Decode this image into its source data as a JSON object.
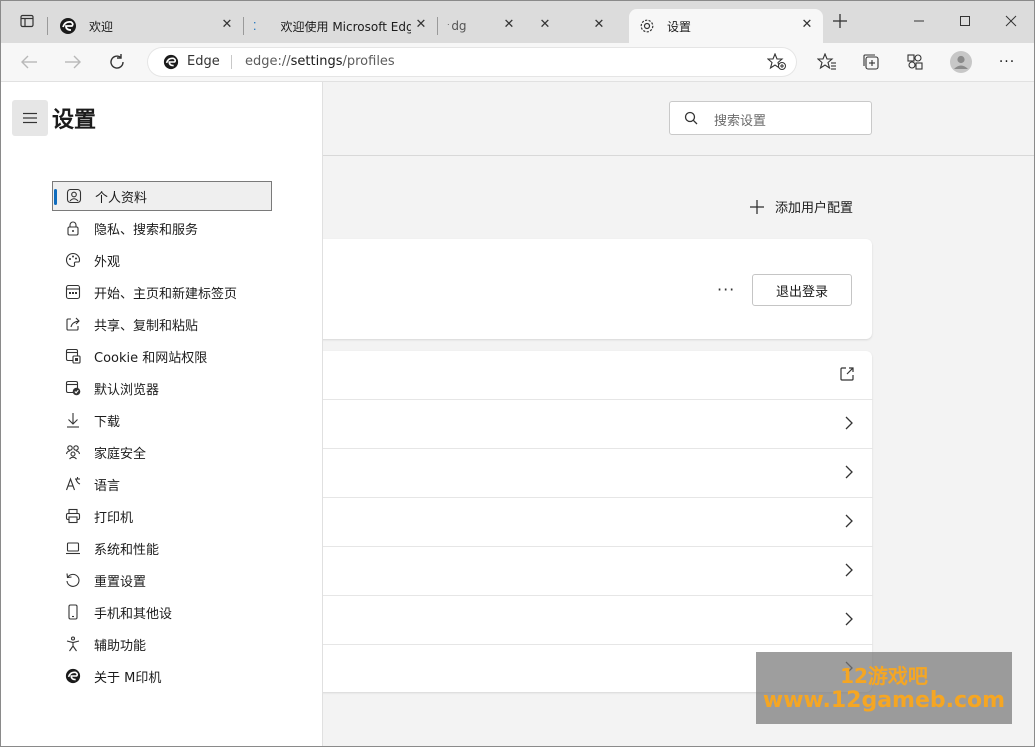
{
  "tabs": [
    {
      "label": "欢迎"
    },
    {
      "label": "欢迎使用 Microsoft Edg"
    },
    {
      "label": "dg"
    },
    {
      "label": ""
    },
    {
      "label": ""
    },
    {
      "label": "设置"
    }
  ],
  "address": {
    "site_label": "Edge",
    "url_prefix": "edge://",
    "url_host": "settings",
    "url_path": "/profiles"
  },
  "settings": {
    "title": "设置",
    "search_placeholder": "搜索设置",
    "add_profile": "添加用户配置",
    "sign_out": "退出登录",
    "more": "···"
  },
  "sidebar": {
    "items": [
      {
        "label": "个人资料",
        "icon": "profile-icon"
      },
      {
        "label": "隐私、搜索和服务",
        "icon": "lock-icon"
      },
      {
        "label": "外观",
        "icon": "palette-icon"
      },
      {
        "label": "开始、主页和新建标签页",
        "icon": "home-grid-icon"
      },
      {
        "label": "共享、复制和粘贴",
        "icon": "share-icon"
      },
      {
        "label": "Cookie 和网站权限",
        "icon": "cookie-icon"
      },
      {
        "label": "默认浏览器",
        "icon": "browser-icon"
      },
      {
        "label": "下载",
        "icon": "download-icon"
      },
      {
        "label": "家庭安全",
        "icon": "family-icon"
      },
      {
        "label": "语言",
        "icon": "language-icon"
      },
      {
        "label": "打印机",
        "icon": "printer-icon"
      },
      {
        "label": "系统和性能",
        "icon": "laptop-icon"
      },
      {
        "label": "重置设置",
        "icon": "reset-icon"
      },
      {
        "label": "手机和其他设",
        "icon": "phone-icon"
      },
      {
        "label": "辅助功能",
        "icon": "accessibility-icon"
      },
      {
        "label": "关于 M印机",
        "icon": "edge-logo-icon"
      }
    ]
  },
  "watermark": {
    "line1": "12游戏吧",
    "line2": "www.12gameb.com"
  },
  "colors": {
    "accent": "#0f6cbd",
    "watermark_text": "#f5a623"
  }
}
